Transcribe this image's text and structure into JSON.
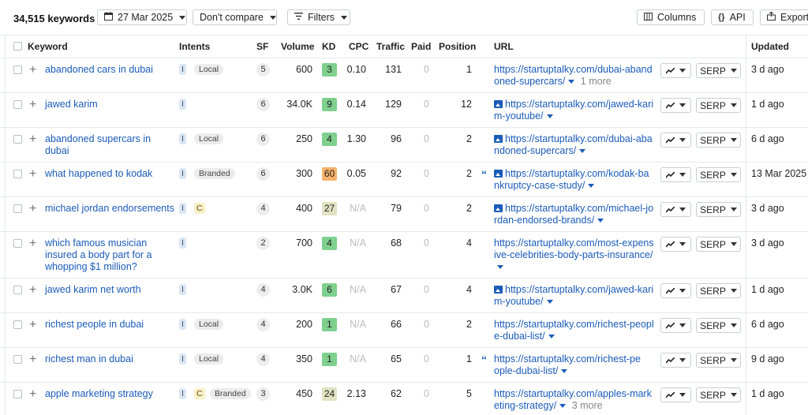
{
  "toolbar": {
    "count": "34,515 keywords",
    "date": "27 Mar 2025",
    "compare": "Don't compare",
    "filters": "Filters",
    "columns": "Columns",
    "api": "API",
    "export": "Export"
  },
  "headers": {
    "keyword": "Keyword",
    "intents": "Intents",
    "sf": "SF",
    "volume": "Volume",
    "kd": "KD",
    "cpc": "CPC",
    "traffic": "Traffic",
    "paid": "Paid",
    "position": "Position",
    "url": "URL",
    "updated": "Updated"
  },
  "serp_label": "SERP",
  "kd_colors": {
    "3": "#7fd08e",
    "9": "#7fd08e",
    "4": "#7fd08e",
    "60": "#f7b26b",
    "27": "#dfe3c2",
    "6": "#7fd08e",
    "1": "#7fd08e",
    "24": "#dfe3c2"
  },
  "rows": [
    {
      "keyword": [
        "abandoned cars in dubai"
      ],
      "intents": [
        "I",
        "Local"
      ],
      "sf": "5",
      "volume": "600",
      "kd": "3",
      "cpc": "0.10",
      "traffic": "131",
      "paid": "0",
      "position": "1",
      "url": [
        "https://startuptalky.com/dubai-aband",
        "oned-supercars/"
      ],
      "url_more": "1 more",
      "url_image": false,
      "quote": false,
      "updated": "3 d ago"
    },
    {
      "keyword": [
        "jawed karim"
      ],
      "intents": [
        "I"
      ],
      "sf": "6",
      "volume": "34.0K",
      "kd": "9",
      "cpc": "0.14",
      "traffic": "129",
      "paid": "0",
      "position": "12",
      "url": [
        "https://startuptalky.com/jawed-kari",
        "m-youtube/"
      ],
      "url_more": "",
      "url_image": true,
      "quote": false,
      "updated": "1 d ago"
    },
    {
      "keyword": [
        "abandoned supercars in",
        "dubai"
      ],
      "intents": [
        "I",
        "Local"
      ],
      "sf": "6",
      "volume": "250",
      "kd": "4",
      "cpc": "1.30",
      "traffic": "96",
      "paid": "0",
      "position": "2",
      "url": [
        "https://startuptalky.com/dubai-aba",
        "ndoned-supercars/"
      ],
      "url_more": "",
      "url_image": true,
      "quote": false,
      "updated": "6 d ago"
    },
    {
      "keyword": [
        "what happened to kodak"
      ],
      "intents": [
        "I",
        "Branded"
      ],
      "sf": "6",
      "volume": "300",
      "kd": "60",
      "cpc": "0.05",
      "traffic": "92",
      "paid": "0",
      "position": "2",
      "url": [
        "https://startuptalky.com/kodak-ba",
        "nkruptcy-case-study/"
      ],
      "url_more": "",
      "url_image": true,
      "quote": true,
      "updated": "13 Mar 2025"
    },
    {
      "keyword": [
        "michael jordan endorsements"
      ],
      "intents": [
        "I",
        "C"
      ],
      "sf": "4",
      "volume": "400",
      "kd": "27",
      "cpc": "N/A",
      "traffic": "79",
      "paid": "0",
      "position": "2",
      "url": [
        "https://startuptalky.com/michael-jo",
        "rdan-endorsed-brands/"
      ],
      "url_more": "",
      "url_image": true,
      "quote": false,
      "updated": "3 d ago"
    },
    {
      "keyword": [
        "which famous musician",
        "insured a body part for a",
        "whopping $1 million?"
      ],
      "intents": [
        "I"
      ],
      "sf": "2",
      "volume": "700",
      "kd": "4",
      "cpc": "N/A",
      "traffic": "68",
      "paid": "0",
      "position": "4",
      "url": [
        "https://startuptalky.com/most-expens",
        "ive-celebrities-body-parts-insurance/",
        ""
      ],
      "url_more": "",
      "url_image": false,
      "quote": false,
      "updated": "3 d ago"
    },
    {
      "keyword": [
        "jawed karim net worth"
      ],
      "intents": [
        "I"
      ],
      "sf": "4",
      "volume": "3.0K",
      "kd": "6",
      "cpc": "N/A",
      "traffic": "67",
      "paid": "0",
      "position": "4",
      "url": [
        "https://startuptalky.com/jawed-kari",
        "m-youtube/"
      ],
      "url_more": "",
      "url_image": true,
      "quote": false,
      "updated": "1 d ago"
    },
    {
      "keyword": [
        "richest people in dubai"
      ],
      "intents": [
        "I",
        "Local"
      ],
      "sf": "4",
      "volume": "200",
      "kd": "1",
      "cpc": "N/A",
      "traffic": "66",
      "paid": "0",
      "position": "2",
      "url": [
        "https://startuptalky.com/richest-peopl",
        "e-dubai-list/"
      ],
      "url_more": "",
      "url_image": false,
      "quote": false,
      "updated": "6 d ago"
    },
    {
      "keyword": [
        "richest man in dubai"
      ],
      "intents": [
        "I",
        "Local"
      ],
      "sf": "4",
      "volume": "350",
      "kd": "1",
      "cpc": "N/A",
      "traffic": "65",
      "paid": "0",
      "position": "1",
      "url": [
        "https://startuptalky.com/richest-pe",
        "ople-dubai-list/"
      ],
      "url_more": "",
      "url_image": false,
      "quote": true,
      "updated": "9 d ago"
    },
    {
      "keyword": [
        "apple marketing strategy"
      ],
      "intents": [
        "I",
        "C",
        "Branded"
      ],
      "sf": "3",
      "volume": "450",
      "kd": "24",
      "cpc": "2.13",
      "traffic": "62",
      "paid": "0",
      "position": "5",
      "url": [
        "https://startuptalky.com/apples-mark",
        "eting-strategy/"
      ],
      "url_more": "3 more",
      "url_image": false,
      "quote": false,
      "updated": "1 d ago"
    }
  ]
}
